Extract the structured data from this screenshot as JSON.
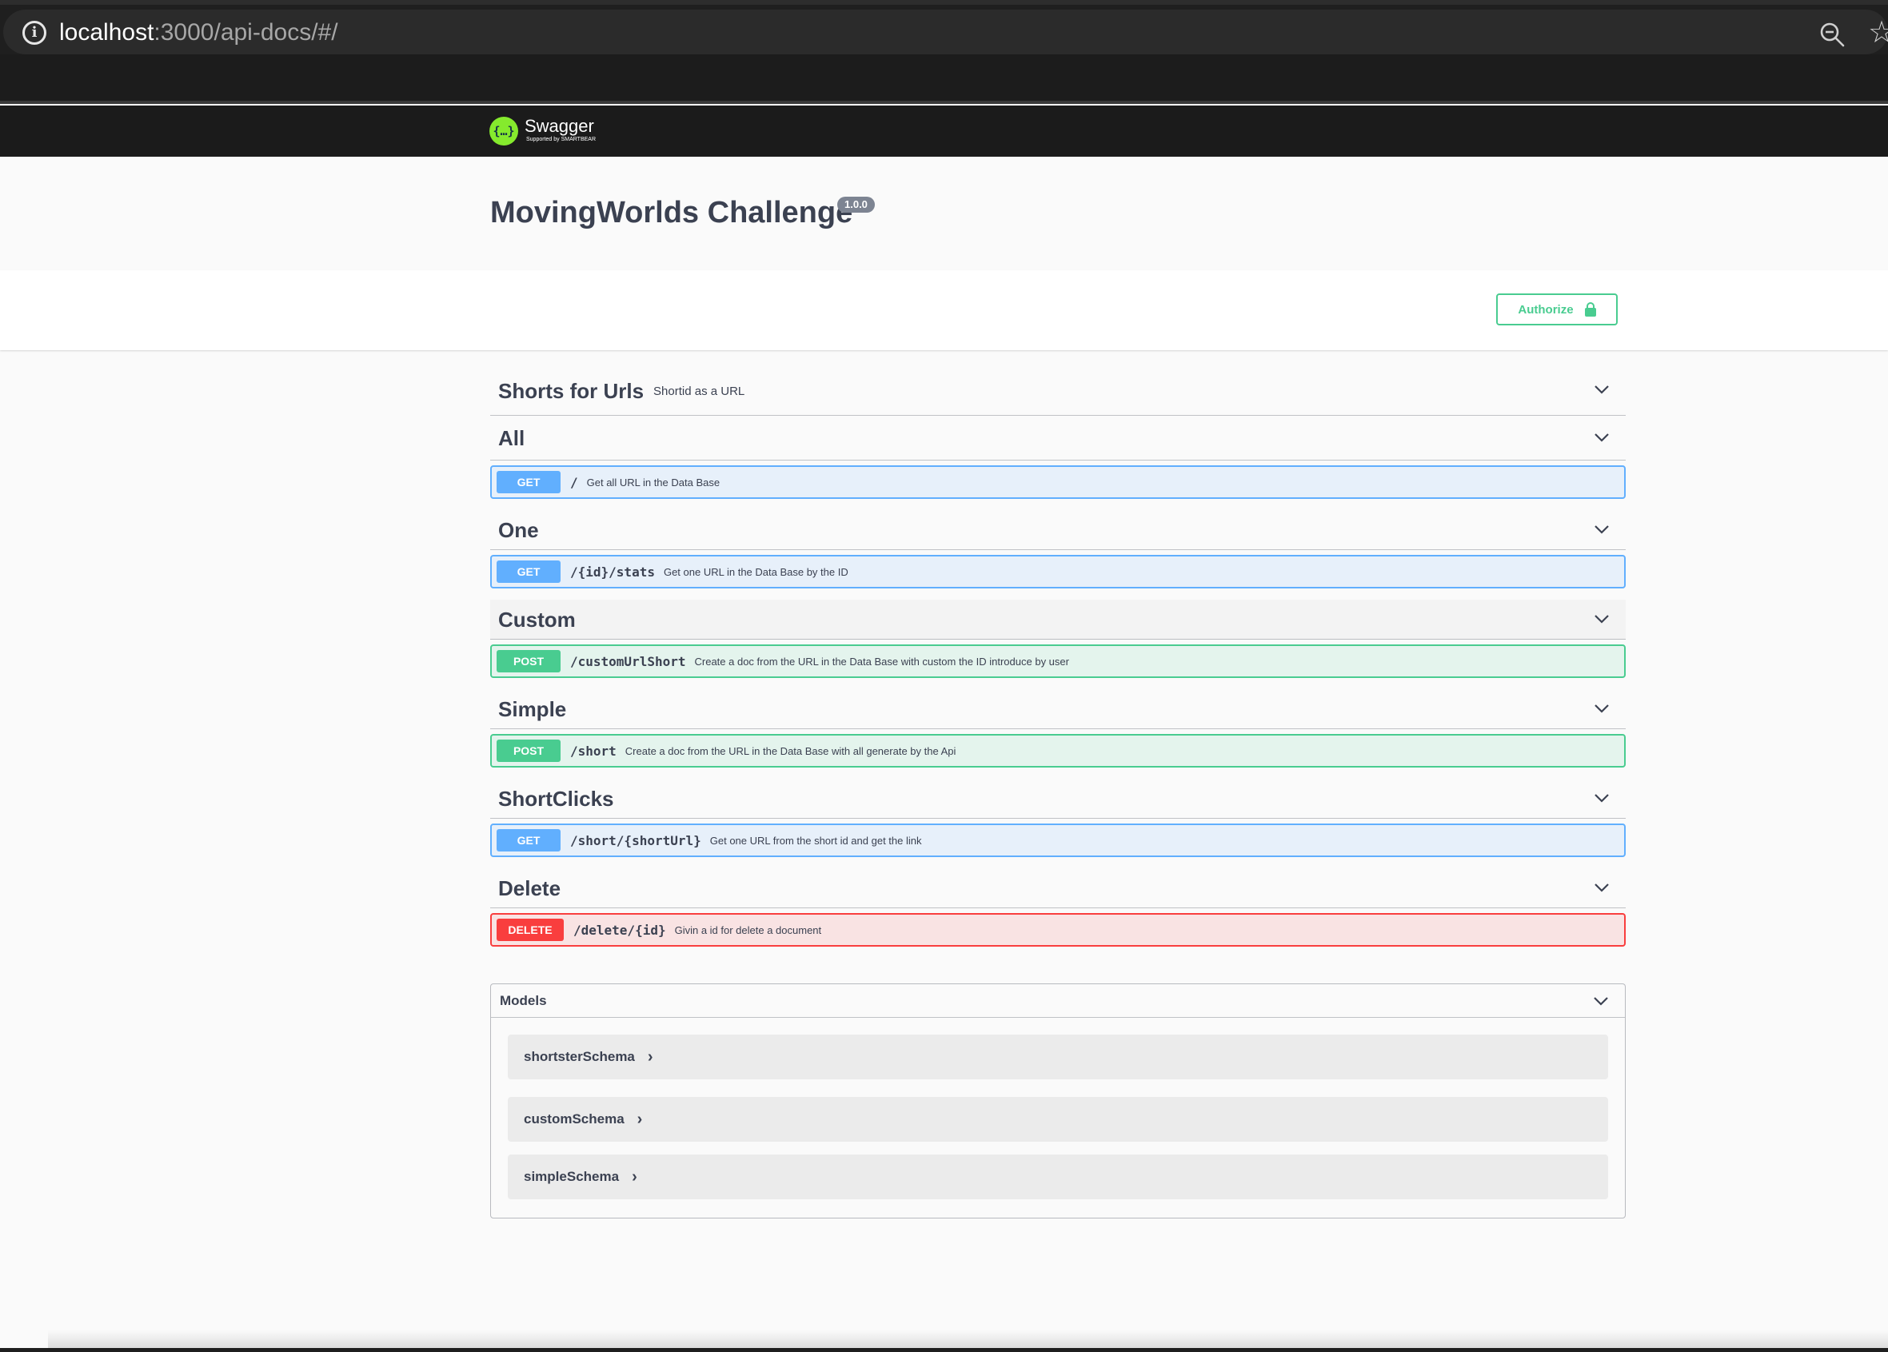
{
  "browser": {
    "url_host": "localhost",
    "url_path": ":3000/api-docs/#/"
  },
  "topbar": {
    "logo_text": "Swagger",
    "logo_sub": "Supported by SMARTBEAR",
    "logo_glyph": "{…}"
  },
  "info": {
    "title": "MovingWorlds Challenge",
    "version": "1.0.0"
  },
  "scheme": {
    "authorize_label": "Authorize"
  },
  "tags": [
    {
      "name": "Shorts for Urls",
      "description": "Shortid as a URL",
      "operations": []
    },
    {
      "name": "All",
      "description": "",
      "operations": [
        {
          "method": "GET",
          "path": "/",
          "summary": "Get all URL in the Data Base"
        }
      ]
    },
    {
      "name": "One",
      "description": "",
      "operations": [
        {
          "method": "GET",
          "path": "/{id}/stats",
          "summary": "Get one URL in the Data Base by the ID"
        }
      ]
    },
    {
      "name": "Custom",
      "description": "",
      "operations": [
        {
          "method": "POST",
          "path": "/customUrlShort",
          "summary": "Create a doc from the URL in the Data Base with custom the ID introduce by user"
        }
      ]
    },
    {
      "name": "Simple",
      "description": "",
      "operations": [
        {
          "method": "POST",
          "path": "/short",
          "summary": "Create a doc from the URL in the Data Base with all generate by the Api"
        }
      ]
    },
    {
      "name": "ShortClicks",
      "description": "",
      "operations": [
        {
          "method": "GET",
          "path": "/short/{shortUrl}",
          "summary": "Get one URL from the short id and get the link"
        }
      ]
    },
    {
      "name": "Delete",
      "description": "",
      "operations": [
        {
          "method": "DELETE",
          "path": "/delete/{id}",
          "summary": "Givin a id for delete a document"
        }
      ]
    }
  ],
  "models": {
    "title": "Models",
    "items": [
      {
        "name": "shortsterSchema"
      },
      {
        "name": "customSchema"
      },
      {
        "name": "simpleSchema"
      }
    ]
  },
  "colors": {
    "get": "#61affe",
    "post": "#49cc90",
    "delete": "#f93e3e",
    "logo_green": "#85ea2d"
  }
}
